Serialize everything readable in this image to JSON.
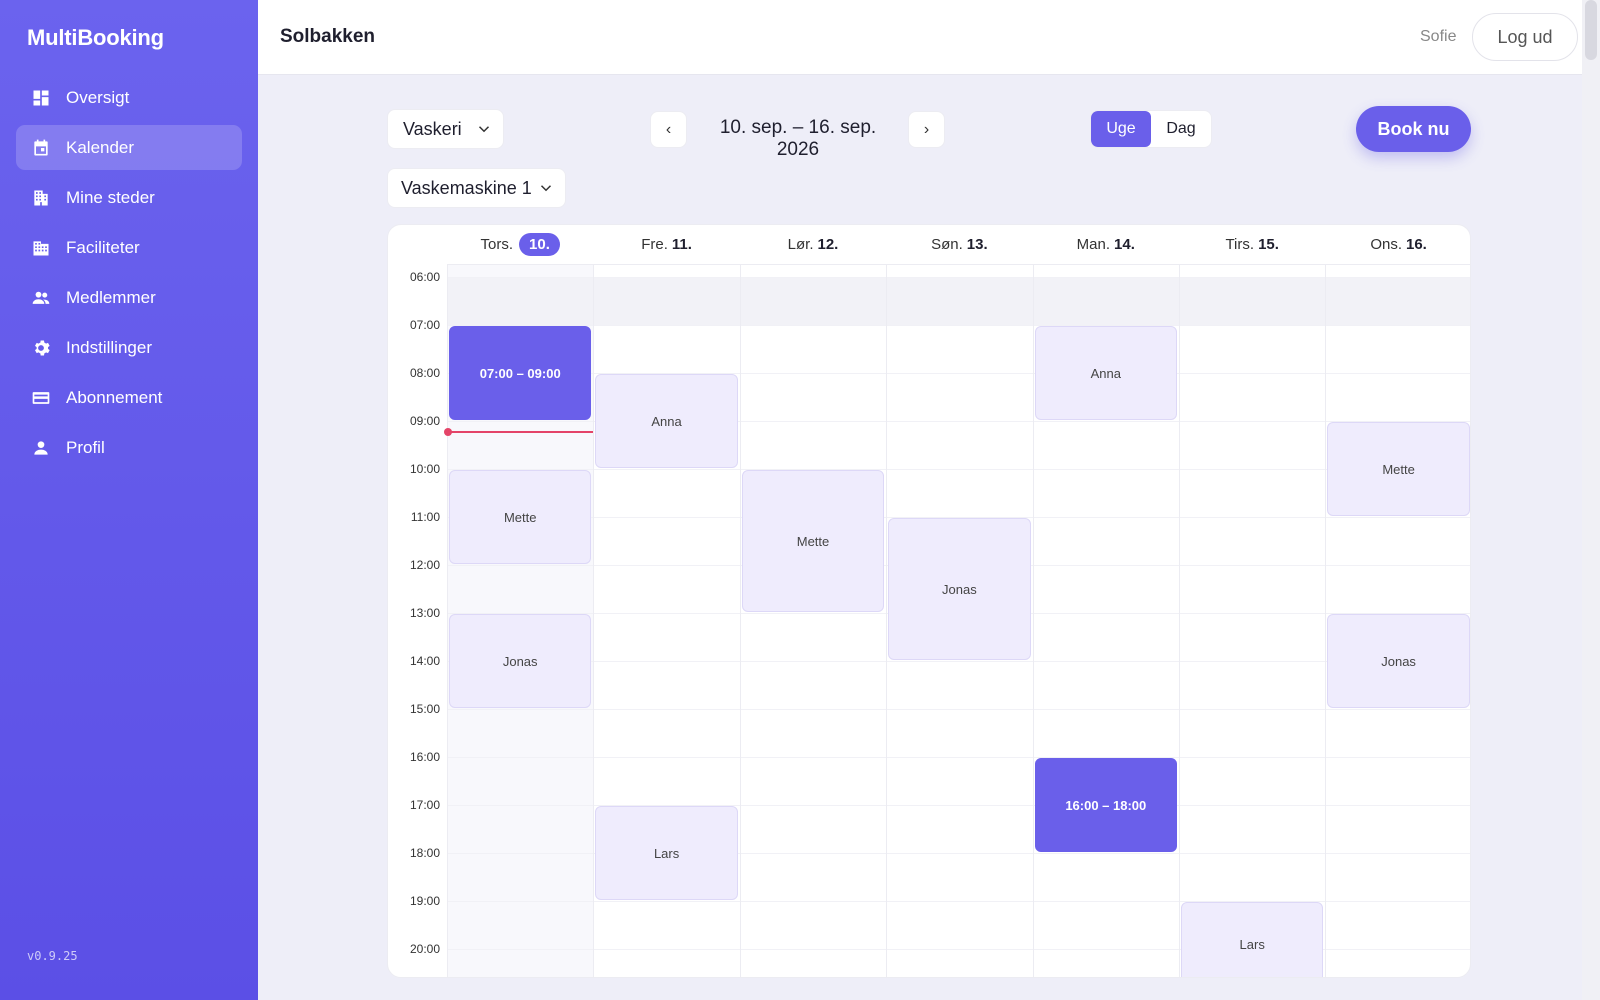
{
  "app": {
    "brand": "MultiBooking",
    "version": "v0.9.25"
  },
  "sidebar": {
    "items": [
      {
        "label": "Oversigt",
        "icon": "dashboard-icon",
        "active": false
      },
      {
        "label": "Kalender",
        "icon": "calendar-icon",
        "active": true
      },
      {
        "label": "Mine steder",
        "icon": "building-icon",
        "active": false
      },
      {
        "label": "Faciliteter",
        "icon": "facilities-icon",
        "active": false
      },
      {
        "label": "Medlemmer",
        "icon": "people-icon",
        "active": false
      },
      {
        "label": "Indstillinger",
        "icon": "gear-icon",
        "active": false
      },
      {
        "label": "Abonnement",
        "icon": "credit-card-icon",
        "active": false
      },
      {
        "label": "Profil",
        "icon": "person-icon",
        "active": false
      }
    ]
  },
  "header": {
    "title": "Solbakken",
    "user": "Sofie",
    "logout_label": "Log ud"
  },
  "controls": {
    "facility": "Vaskeri",
    "unit": "Vaskemaskine 1",
    "date_range": "10. sep. – 16. sep. 2026",
    "views": [
      "Uge",
      "Dag"
    ],
    "active_view": "Uge",
    "book_label": "Book nu"
  },
  "calendar": {
    "days": [
      {
        "name": "Tors.",
        "num": "10.",
        "today": true
      },
      {
        "name": "Fre.",
        "num": "11.",
        "today": false
      },
      {
        "name": "Lør.",
        "num": "12.",
        "today": false
      },
      {
        "name": "Søn.",
        "num": "13.",
        "today": false
      },
      {
        "name": "Man.",
        "num": "14.",
        "today": false
      },
      {
        "name": "Tirs.",
        "num": "15.",
        "today": false
      },
      {
        "name": "Ons.",
        "num": "16.",
        "today": false
      }
    ],
    "hours": [
      "06:00",
      "07:00",
      "08:00",
      "09:00",
      "10:00",
      "11:00",
      "12:00",
      "13:00",
      "14:00",
      "15:00",
      "16:00",
      "17:00",
      "18:00",
      "19:00",
      "20:00"
    ],
    "now": {
      "day": 0,
      "hour": 9.2
    },
    "bookings": [
      {
        "day": 0,
        "start": 7,
        "end": 9,
        "label": "07:00 – 09:00",
        "mine": true
      },
      {
        "day": 0,
        "start": 10,
        "end": 12,
        "label": "Mette",
        "mine": false
      },
      {
        "day": 0,
        "start": 13,
        "end": 15,
        "label": "Jonas",
        "mine": false
      },
      {
        "day": 1,
        "start": 8,
        "end": 10,
        "label": "Anna",
        "mine": false
      },
      {
        "day": 1,
        "start": 17,
        "end": 19,
        "label": "Lars",
        "mine": false
      },
      {
        "day": 2,
        "start": 10,
        "end": 13,
        "label": "Mette",
        "mine": false
      },
      {
        "day": 3,
        "start": 11,
        "end": 14,
        "label": "Jonas",
        "mine": false
      },
      {
        "day": 4,
        "start": 7,
        "end": 9,
        "label": "Anna",
        "mine": false
      },
      {
        "day": 4,
        "start": 16,
        "end": 18,
        "label": "16:00 – 18:00",
        "mine": true
      },
      {
        "day": 5,
        "start": 19,
        "end": 21,
        "label": "Lars",
        "mine": false
      },
      {
        "day": 6,
        "start": 9,
        "end": 11,
        "label": "Mette",
        "mine": false
      },
      {
        "day": 6,
        "start": 13,
        "end": 15,
        "label": "Jonas",
        "mine": false
      }
    ]
  }
}
